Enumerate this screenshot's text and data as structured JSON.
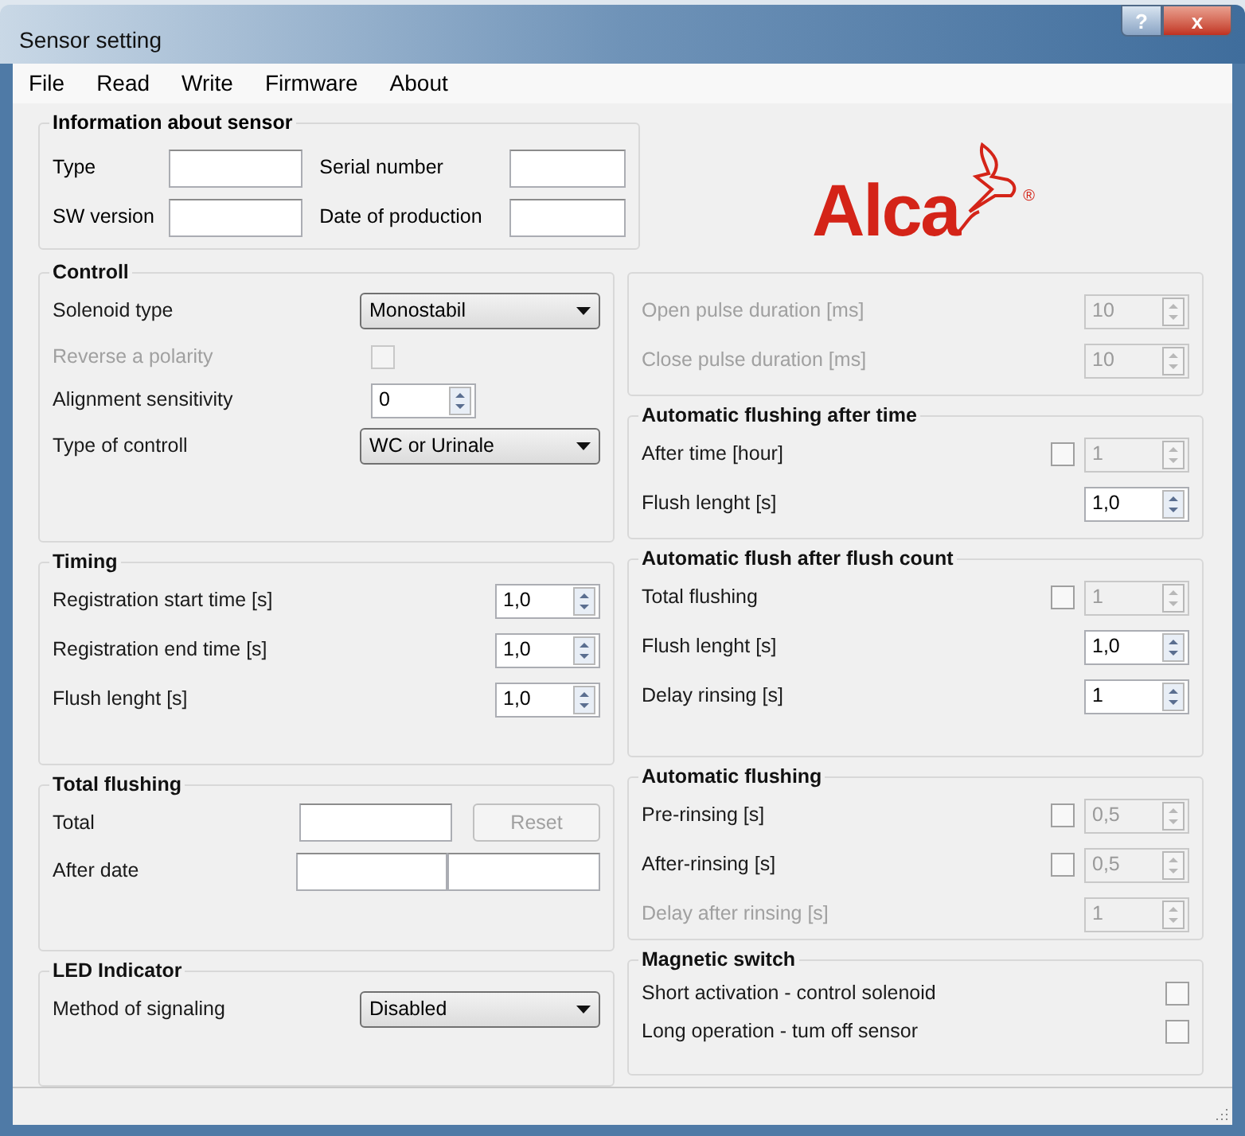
{
  "window": {
    "title": "Sensor setting",
    "buttons": [
      {
        "kind": "help",
        "label": "?"
      },
      {
        "kind": "close",
        "label": "x"
      }
    ]
  },
  "menu": [
    "File",
    "Read",
    "Write",
    "Firmware",
    "About"
  ],
  "info": {
    "title": "Information about sensor",
    "rows": [
      {
        "label": "Type",
        "value_label": "Serial number"
      },
      {
        "label": "SW version",
        "value_label": "Date of production"
      }
    ]
  },
  "logo": {
    "text": "Alca",
    "mark": "®"
  },
  "left": [
    {
      "title": "Controll",
      "rows": [
        {
          "kind": "dropdown",
          "label": "Solenoid type",
          "disabled": false,
          "value": "Monostabil"
        },
        {
          "kind": "checkbox",
          "label": "Reverse a polarity",
          "disabled": true,
          "checked": false
        },
        {
          "kind": "spin_small",
          "label": "Alignment sensitivity",
          "disabled": false,
          "value": "0"
        },
        {
          "kind": "dropdown",
          "label": "Type of controll",
          "disabled": false,
          "value": "WC or Urinale"
        }
      ]
    },
    {
      "title": "Timing",
      "rows": [
        {
          "kind": "spin",
          "label": "Registration start time [s]",
          "disabled": false,
          "value": "1,0"
        },
        {
          "kind": "spin",
          "label": "Registration end time [s]",
          "disabled": false,
          "value": "1,0"
        },
        {
          "kind": "spin",
          "label": "Flush lenght [s]",
          "disabled": false,
          "value": "1,0"
        }
      ]
    },
    {
      "title": "Total flushing",
      "rows": [
        {
          "kind": "field_button",
          "label": "Total",
          "disabled": false,
          "button": "Reset",
          "button_disabled": true
        },
        {
          "kind": "two_fields",
          "label": "After date",
          "disabled": false
        }
      ]
    },
    {
      "title": "LED Indicator",
      "rows": [
        {
          "kind": "dropdown",
          "label": "Method of signaling",
          "disabled": false,
          "value": "Disabled"
        }
      ]
    }
  ],
  "right": [
    {
      "rows": [
        {
          "kind": "spin",
          "label": "Open pulse duration [ms]",
          "disabled": true,
          "value": "10"
        },
        {
          "kind": "spin",
          "label": "Close pulse duration [ms]",
          "disabled": true,
          "value": "10"
        }
      ]
    },
    {
      "title": "Automatic flushing after time",
      "rows": [
        {
          "kind": "check_spin",
          "label": "After time [hour]",
          "disabled": false,
          "checked": false,
          "value": "1"
        },
        {
          "kind": "spin",
          "label": "Flush lenght [s]",
          "disabled": false,
          "value": "1,0"
        }
      ]
    },
    {
      "title": "Automatic flush after flush count",
      "rows": [
        {
          "kind": "check_spin",
          "label": "Total flushing",
          "disabled": false,
          "checked": false,
          "value": "1"
        },
        {
          "kind": "spin",
          "label": "Flush lenght [s]",
          "disabled": false,
          "value": "1,0"
        },
        {
          "kind": "spin",
          "label": "Delay rinsing [s]",
          "disabled": false,
          "value": "1"
        }
      ]
    },
    {
      "title": "Automatic flushing",
      "rows": [
        {
          "kind": "check_spin",
          "label": "Pre-rinsing [s]",
          "disabled": false,
          "checked": false,
          "value": "0,5"
        },
        {
          "kind": "check_spin",
          "label": "After-rinsing [s]",
          "disabled": false,
          "checked": false,
          "value": "0,5"
        },
        {
          "kind": "spin",
          "label": "Delay after rinsing [s]",
          "disabled": true,
          "value": "1"
        }
      ]
    },
    {
      "title": "Magnetic switch",
      "rows": [
        {
          "kind": "checkbox_right",
          "label": "Short activation - control solenoid",
          "disabled": false,
          "checked": false
        },
        {
          "kind": "checkbox_right",
          "label": "Long operation - tum off sensor",
          "disabled": false,
          "checked": false
        }
      ]
    }
  ]
}
